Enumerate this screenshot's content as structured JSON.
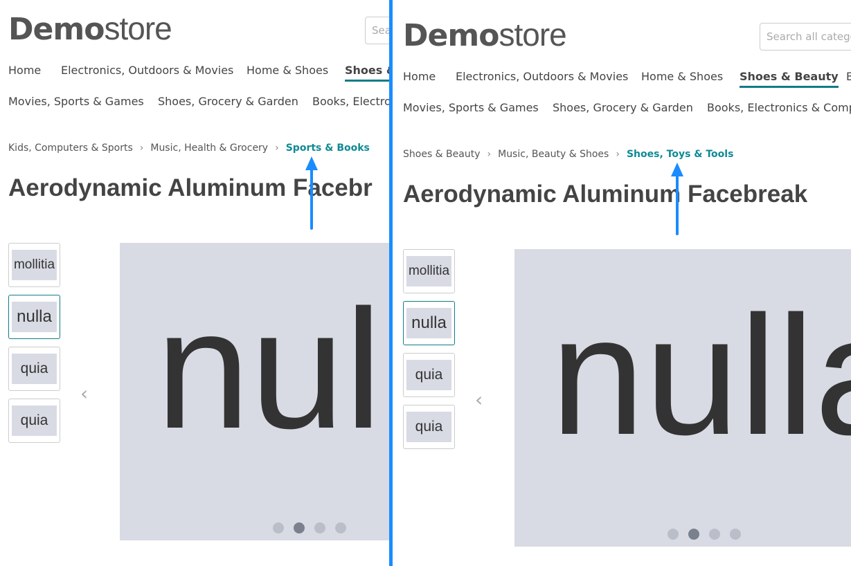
{
  "accent_color": "#0e7c86",
  "annotation_color": "#1a8cff",
  "panels": [
    {
      "id": "left",
      "logo_bold": "Demo",
      "logo_light": "store",
      "search_placeholder": "Sea",
      "nav_row1": [
        {
          "label": "Home"
        },
        {
          "label": "Electronics, Outdoors & Movies"
        },
        {
          "label": "Home & Shoes"
        },
        {
          "label": "Shoes &",
          "active": true
        }
      ],
      "nav_row2": [
        {
          "label": "Movies, Sports & Games"
        },
        {
          "label": "Shoes, Grocery & Garden"
        },
        {
          "label": "Books, Electron"
        }
      ],
      "breadcrumb": [
        "Kids, Computers & Sports",
        "Music, Health & Grocery",
        "Sports & Books"
      ],
      "title": "Aerodynamic Aluminum Facebr",
      "thumbnails": [
        {
          "label": "mollitia"
        },
        {
          "label": "nulla",
          "selected": true
        },
        {
          "label": "quia"
        },
        {
          "label": "quia"
        }
      ],
      "main_image_text": "nulla",
      "carousel_active_index": 1,
      "carousel_count": 4
    },
    {
      "id": "right",
      "logo_bold": "Demo",
      "logo_light": "store",
      "search_placeholder": "Search all categori",
      "nav_row1": [
        {
          "label": "Home"
        },
        {
          "label": "Electronics, Outdoors & Movies"
        },
        {
          "label": "Home & Shoes"
        },
        {
          "label": "Shoes & Beauty",
          "active": true
        },
        {
          "label": "B"
        }
      ],
      "nav_row2": [
        {
          "label": "Movies, Sports & Games"
        },
        {
          "label": "Shoes, Grocery & Garden"
        },
        {
          "label": "Books, Electronics & Compu"
        }
      ],
      "breadcrumb": [
        "Shoes & Beauty",
        "Music, Beauty & Shoes",
        "Shoes, Toys & Tools"
      ],
      "title": "Aerodynamic Aluminum Facebreak",
      "thumbnails": [
        {
          "label": "mollitia"
        },
        {
          "label": "nulla",
          "selected": true
        },
        {
          "label": "quia"
        },
        {
          "label": "quia"
        }
      ],
      "main_image_text": "nulla",
      "carousel_active_index": 1,
      "carousel_count": 4
    }
  ]
}
